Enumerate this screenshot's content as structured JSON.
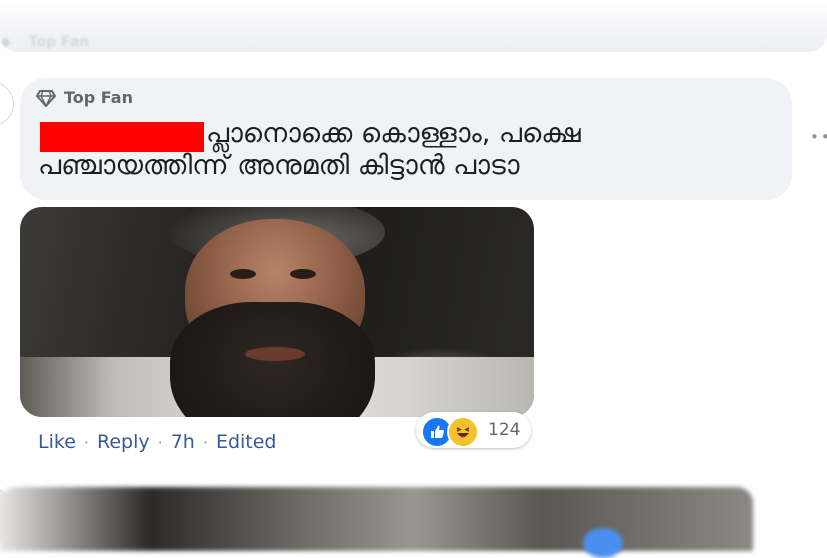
{
  "previous_comment": {
    "badge": "Top Fan"
  },
  "comment": {
    "badge": "Top Fan",
    "text_line1": "പ്ലാനൊക്കെ കൊള്ളാം, പക്ഷെ",
    "text_line2": "പഞ്ചായത്തിന്ന് അനുമതി കിട്ടാൻ പാടാ",
    "actions": {
      "like": "Like",
      "reply": "Reply",
      "time": "7h",
      "edited": "Edited",
      "separator": "·"
    },
    "reactions": {
      "count": "124",
      "types": [
        "like-icon",
        "haha-icon"
      ]
    },
    "colors": {
      "redaction": "#ff0000",
      "link": "#385898",
      "bubble": "#f0f2f5"
    }
  }
}
